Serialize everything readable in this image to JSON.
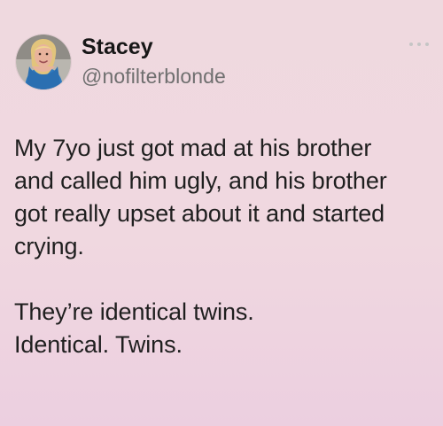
{
  "tweet": {
    "author": {
      "name": "Stacey",
      "handle": "@nofilterblonde"
    },
    "body": {
      "paragraph_1": "My 7yo just got mad at his brother\nand called him ugly, and his brother\ngot really upset about it and started\ncrying.",
      "paragraph_2": "They’re identical twins.\nIdentical. Twins."
    },
    "icons": {
      "more": "more-options-icon",
      "avatar": "profile-photo"
    },
    "colors": {
      "background_top": "#efd9df",
      "background_bottom": "#eccfe0",
      "text": "#1f1f1f",
      "handle": "#6f6f6f"
    }
  }
}
